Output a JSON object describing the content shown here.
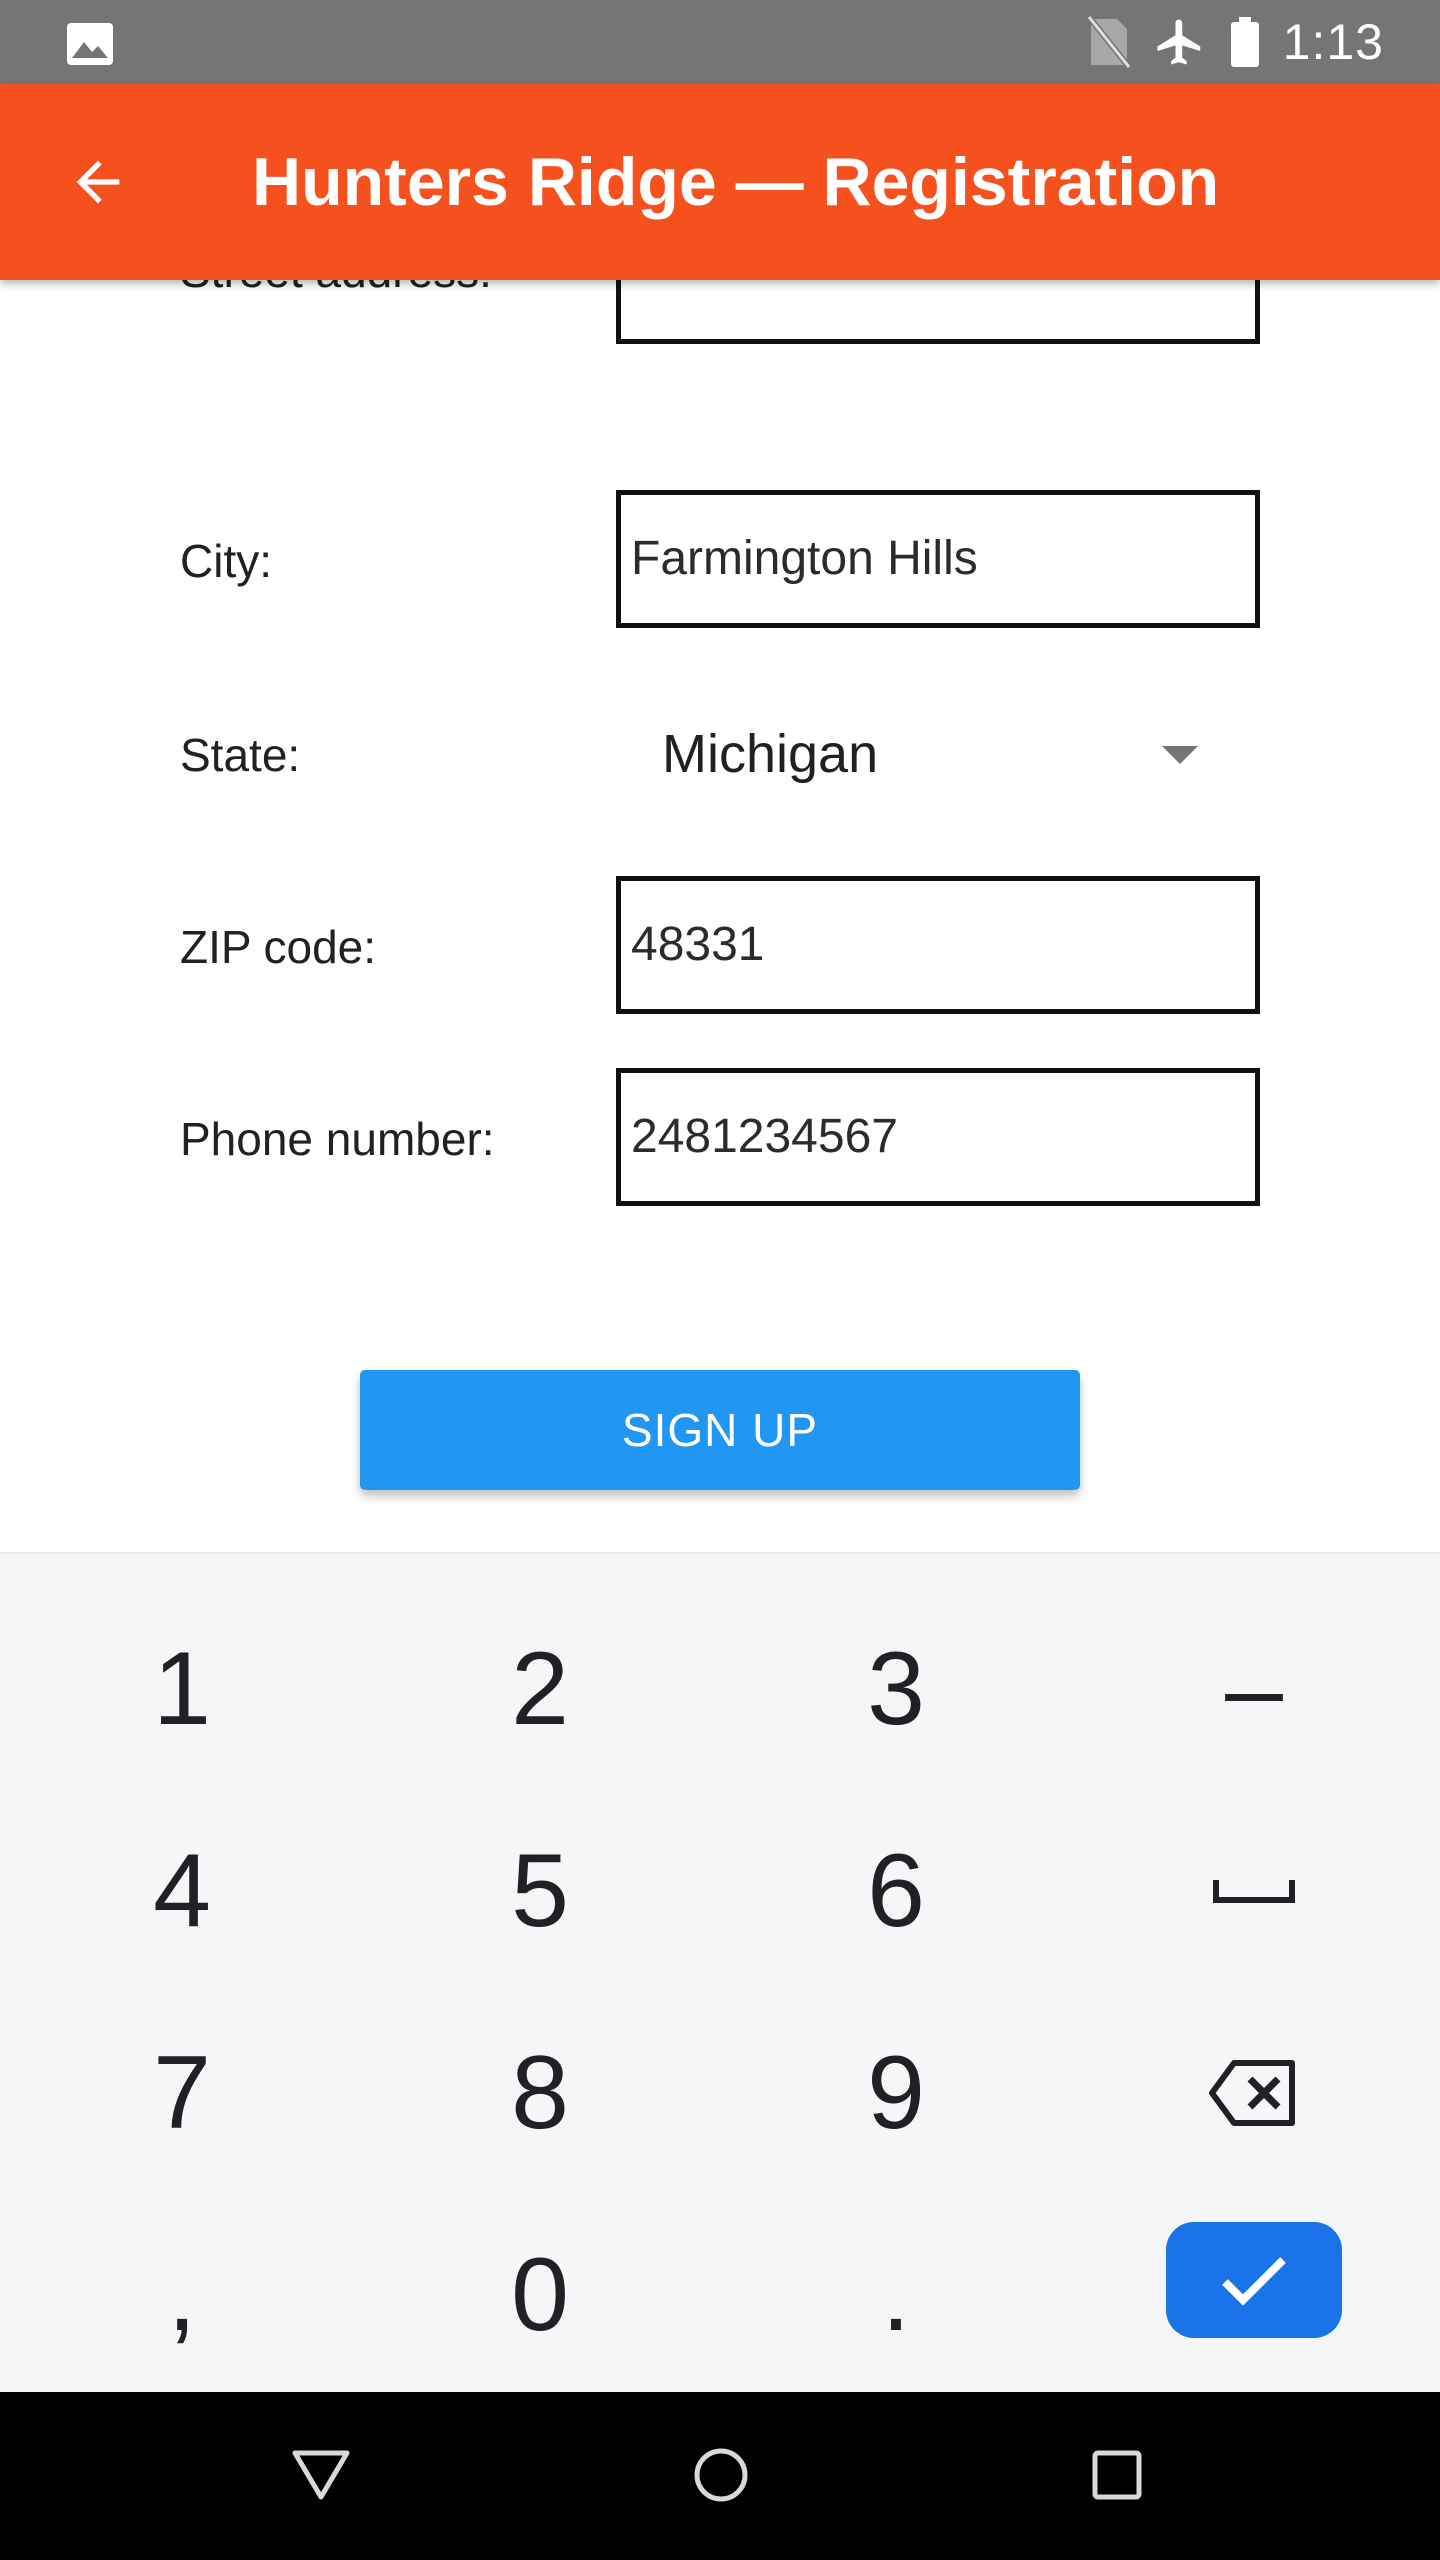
{
  "status_bar": {
    "time": "1:13",
    "icons": [
      "gallery-notification-icon",
      "no-sim-icon",
      "airplane-mode-icon",
      "battery-icon"
    ]
  },
  "app_bar": {
    "title": "Hunters Ridge — Registration",
    "back_icon": "arrow-back-icon"
  },
  "form": {
    "street_address": {
      "label": "Street address:",
      "value": ""
    },
    "city": {
      "label": "City:",
      "value": "Farmington Hills"
    },
    "state": {
      "label": "State:",
      "value": "Michigan"
    },
    "zip": {
      "label": "ZIP code:",
      "value": "48331"
    },
    "phone": {
      "label": "Phone number:",
      "value": "2481234567"
    },
    "submit_label": "SIGN UP"
  },
  "keyboard": {
    "rows": [
      [
        "1",
        "2",
        "3",
        "–"
      ],
      [
        "4",
        "5",
        "6",
        "space"
      ],
      [
        "7",
        "8",
        "9",
        "backspace"
      ],
      [
        ",",
        "0",
        ".",
        "done"
      ]
    ]
  },
  "nav_bar": {
    "icons": [
      "back-triangle-icon",
      "home-circle-icon",
      "recents-square-icon"
    ]
  }
}
